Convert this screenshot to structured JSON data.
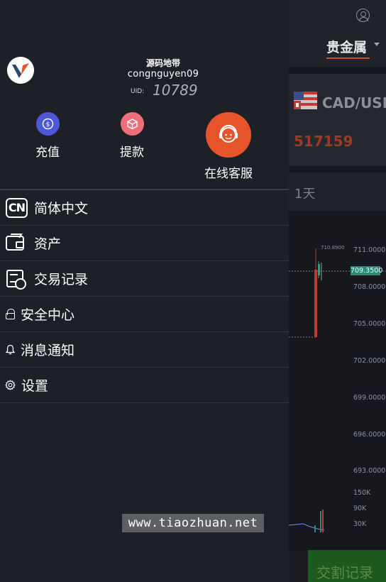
{
  "background": {
    "category": "贵金属",
    "symbol": "CAD/USD",
    "price": "517159",
    "period": "1天",
    "chart": {
      "high_label": "710.8900",
      "current_price": "709.3500",
      "price_ticks": [
        "711.0000",
        "708.0000",
        "705.0000",
        "702.0000",
        "699.0000",
        "696.0000",
        "693.0000"
      ],
      "volume_ticks": [
        "150K",
        "90K",
        "30K"
      ]
    },
    "trade_button": "交割记录"
  },
  "drawer": {
    "brand": "源码地带",
    "username": "congnguyen09",
    "uid_label": "UID:",
    "uid_value": "10789",
    "actions": {
      "deposit": "充值",
      "withdraw": "提款",
      "support": "在线客服"
    },
    "menu": [
      {
        "icon_text": "CN",
        "label": "简体中文",
        "icon": "language-cn-icon"
      },
      {
        "label": "资产",
        "icon": "wallet-icon"
      },
      {
        "label": "交易记录",
        "icon": "record-icon"
      },
      {
        "label": "安全中心",
        "icon": "lock-icon"
      },
      {
        "label": "消息通知",
        "icon": "bell-icon"
      },
      {
        "label": "设置",
        "icon": "gear-icon"
      }
    ]
  },
  "watermark": "www.tiaozhuan.net",
  "colors": {
    "drawer_bg": "#1e2027",
    "support_orange": "#e5542a",
    "deposit_blue": "#4f57d9",
    "withdraw_pink": "#ee6f7c",
    "accent_line": "#c8512b"
  }
}
